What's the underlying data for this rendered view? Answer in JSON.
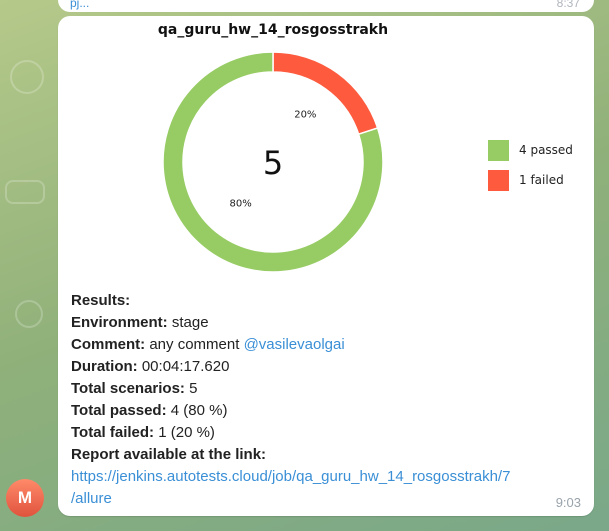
{
  "previous_message": {
    "link_fragment": "pj...",
    "time": "8:37"
  },
  "avatar": {
    "letter": "M",
    "color": "#e0533d"
  },
  "chart_data": {
    "type": "pie",
    "title": "qa_guru_hw_14_rosgosstrakh",
    "center_label": "5",
    "categories": [
      "4 passed",
      "1 failed"
    ],
    "values": [
      4,
      1
    ],
    "percent_labels": [
      "80%",
      "20%"
    ],
    "colors": [
      "#97cc64",
      "#fd5a3e"
    ],
    "legend_position": "right"
  },
  "report": {
    "heading": "Results:",
    "environment_label": "Environment:",
    "environment_value": "stage",
    "comment_label": "Comment:",
    "comment_value": "any comment",
    "comment_mention": "@vasilevaolgai",
    "duration_label": "Duration:",
    "duration_value": "00:04:17.620",
    "total_scenarios_label": "Total scenarios:",
    "total_scenarios_value": "5",
    "total_passed_label": "Total passed:",
    "total_passed_value": "4 (80 %)",
    "total_failed_label": "Total failed:",
    "total_failed_value": "1 (20 %)",
    "link_label": "Report available at the link:",
    "link_line1": "https://jenkins.autotests.cloud/job/qa_guru_hw_14_rosgosstrakh/7",
    "link_line2": "/allure"
  },
  "message_time": "9:03"
}
